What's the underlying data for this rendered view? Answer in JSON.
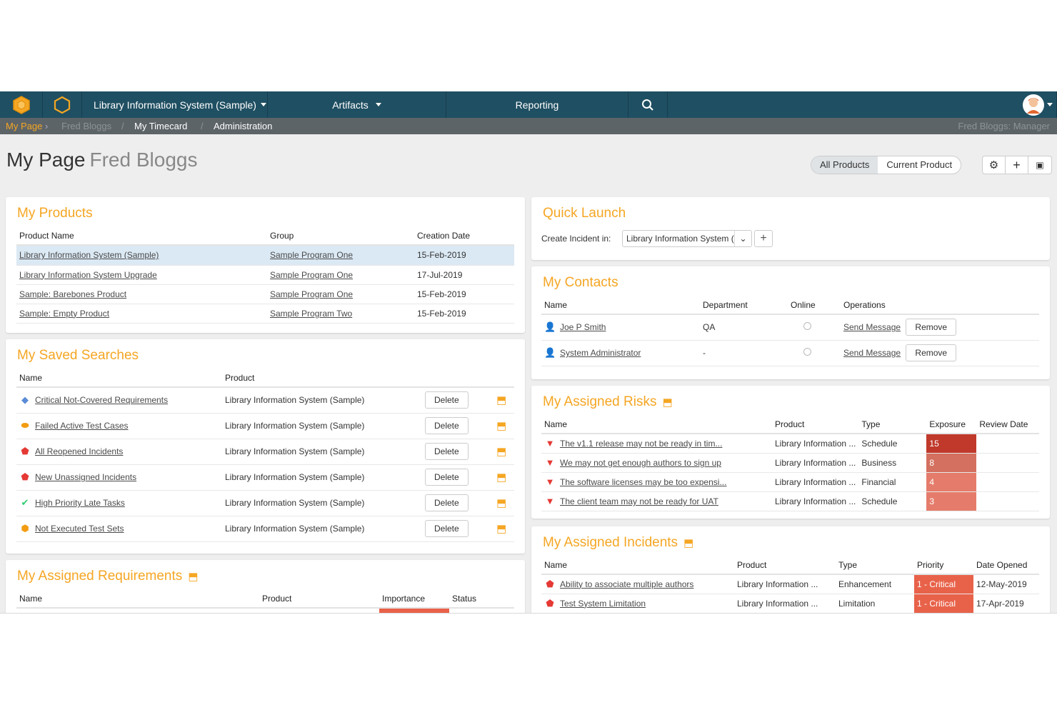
{
  "nav": {
    "product": "Library Information System (Sample)",
    "artifacts": "Artifacts",
    "reporting": "Reporting",
    "icons": [
      "spira-logo-icon",
      "hexagon-icon",
      "search-icon",
      "user-avatar-icon"
    ]
  },
  "breadcrumb": {
    "my_page": "My Page",
    "user": "Fred Bloggs",
    "timecard": "My Timecard",
    "admin": "Administration",
    "role": "Fred Bloggs: Manager"
  },
  "title": {
    "main": "My Page",
    "sub": "Fred Bloggs"
  },
  "scope_toggle": {
    "all": "All Products",
    "current": "Current Product"
  },
  "products": {
    "title": "My Products",
    "headers": [
      "Product Name",
      "Group",
      "Creation Date"
    ],
    "rows": [
      {
        "name": "Library Information System (Sample)",
        "group": "Sample Program One",
        "date": "15-Feb-2019"
      },
      {
        "name": "Library Information System Upgrade",
        "group": "Sample Program One",
        "date": "17-Jul-2019"
      },
      {
        "name": "Sample: Barebones Product",
        "group": "Sample Program One",
        "date": "15-Feb-2019"
      },
      {
        "name": "Sample: Empty Product",
        "group": "Sample Program Two",
        "date": "15-Feb-2019"
      }
    ]
  },
  "searches": {
    "title": "My Saved Searches",
    "headers": [
      "Name",
      "Product"
    ],
    "delete_label": "Delete",
    "rows": [
      {
        "name": "Critical Not-Covered Requirements",
        "product": "Library Information System (Sample)",
        "icon": "requirement-icon"
      },
      {
        "name": "Failed Active Test Cases",
        "product": "Library Information System (Sample)",
        "icon": "test-case-icon"
      },
      {
        "name": "All Reopened Incidents",
        "product": "Library Information System (Sample)",
        "icon": "incident-icon"
      },
      {
        "name": "New Unassigned Incidents",
        "product": "Library Information System (Sample)",
        "icon": "incident-icon"
      },
      {
        "name": "High Priority Late Tasks",
        "product": "Library Information System (Sample)",
        "icon": "task-icon"
      },
      {
        "name": "Not Executed Test Sets",
        "product": "Library Information System (Sample)",
        "icon": "test-set-icon"
      }
    ]
  },
  "requirements": {
    "title": "My Assigned Requirements",
    "headers": [
      "Name",
      "Product",
      "Importance",
      "Status"
    ]
  },
  "quick_launch": {
    "title": "Quick Launch",
    "label": "Create Incident in:",
    "selected": "Library Information System (Sample)"
  },
  "contacts": {
    "title": "My Contacts",
    "headers": [
      "Name",
      "Department",
      "Online",
      "Operations"
    ],
    "send_label": "Send Message",
    "remove_label": "Remove",
    "rows": [
      {
        "name": "Joe P Smith",
        "department": "QA"
      },
      {
        "name": "System Administrator",
        "department": "-"
      }
    ]
  },
  "risks": {
    "title": "My Assigned Risks",
    "headers": [
      "Name",
      "Product",
      "Type",
      "Exposure",
      "Review Date"
    ],
    "rows": [
      {
        "name": "The v1.1 release may not be ready in tim...",
        "product": "Library Information ...",
        "type": "Schedule",
        "exposure": "15",
        "color": "#c0392b"
      },
      {
        "name": "We may not get enough authors to sign up",
        "product": "Library Information ...",
        "type": "Business",
        "exposure": "8",
        "color": "#d4705f"
      },
      {
        "name": "The software licenses may be too expensi...",
        "product": "Library Information ...",
        "type": "Financial",
        "exposure": "4",
        "color": "#e57c6b"
      },
      {
        "name": "The client team may not be ready for UAT",
        "product": "Library Information ...",
        "type": "Schedule",
        "exposure": "3",
        "color": "#e57c6b"
      }
    ]
  },
  "incidents": {
    "title": "My Assigned Incidents",
    "headers": [
      "Name",
      "Product",
      "Type",
      "Priority",
      "Date Opened"
    ],
    "rows": [
      {
        "name": "Ability to associate multiple authors",
        "product": "Library Information ...",
        "type": "Enhancement",
        "priority": "1 - Critical",
        "date": "12-May-2019"
      },
      {
        "name": "Test System Limitation",
        "product": "Library Information ...",
        "type": "Limitation",
        "priority": "1 - Critical",
        "date": "17-Apr-2019"
      }
    ]
  },
  "colors": {
    "nav": "#1f4f62",
    "accent": "#f5a623",
    "critical": "#e8624a"
  }
}
